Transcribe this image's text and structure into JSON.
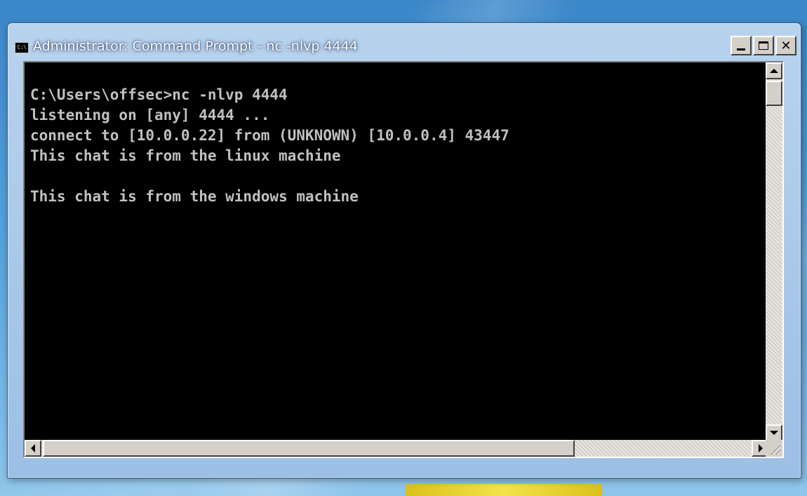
{
  "window": {
    "title": "Administrator: Command Prompt - nc  -nlvp 4444",
    "icon": "cmd-icon",
    "icon_text": "C:\\",
    "controls": {
      "minimize": "minimize-icon",
      "maximize": "maximize-icon",
      "close_label": "✕"
    }
  },
  "console": {
    "background": "#000000",
    "foreground": "#c0c0c0",
    "lines": [
      "C:\\Users\\offsec>nc -nlvp 4444",
      "listening on [any] 4444 ...",
      "connect to [10.0.0.22] from (UNKNOWN) [10.0.0.4] 43447",
      "This chat is from the linux machine",
      "",
      "This chat is from the windows machine"
    ]
  },
  "scrollbars": {
    "vertical": {
      "up": "arrow-up-icon",
      "down": "arrow-down-icon"
    },
    "horizontal": {
      "left": "arrow-left-icon",
      "right": "arrow-right-icon"
    }
  },
  "colors": {
    "desktop": "#4a96d4",
    "chrome": "#d4d0c8",
    "frame": "#b9d3ee"
  }
}
